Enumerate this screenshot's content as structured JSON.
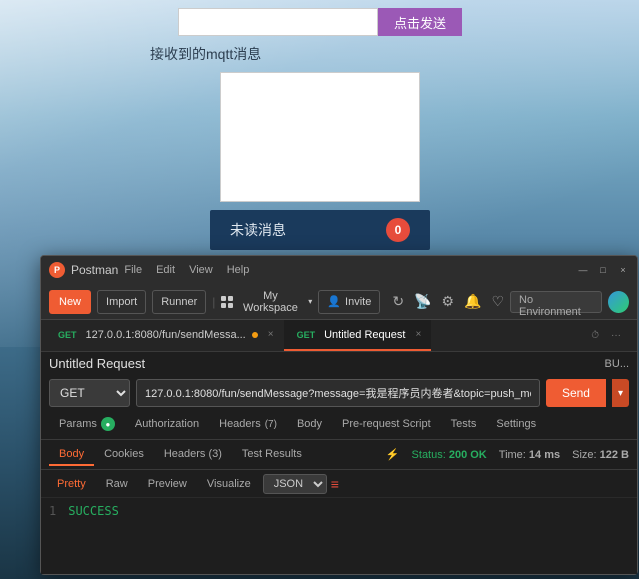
{
  "background": {
    "gradient_desc": "sky and mountain landscape"
  },
  "web_page": {
    "send_input_placeholder": "",
    "send_button_label": "点击发送",
    "mqtt_label": "接收到的mqtt消息",
    "textarea_content": "",
    "unread_text": "未读消息",
    "unread_count": "0"
  },
  "postman": {
    "title": "Postman",
    "menu": {
      "file": "File",
      "edit": "Edit",
      "view": "View",
      "help": "Help"
    },
    "toolbar": {
      "new_label": "New",
      "import_label": "Import",
      "runner_label": "Runner",
      "workspace_label": "My Workspace",
      "invite_label": "Invite"
    },
    "env_selector": "No Environment",
    "tabs": [
      {
        "method": "GET",
        "url": "127.0.0.1:8080/fun/sendMessa...",
        "has_dot": true,
        "is_active": false
      },
      {
        "method": "GET",
        "url": "Untitled Request",
        "has_dot": false,
        "is_active": true
      }
    ],
    "request": {
      "name": "Untitled Request",
      "method": "GET",
      "url": "127.0.0.1:8080/fun/sendMessage?message=我是程序员内卷者&topic=push_message_topic",
      "send_label": "Send",
      "params_tabs": [
        {
          "label": "Params",
          "badge": true,
          "badge_color": "#27ae60",
          "active": false
        },
        {
          "label": "Authorization",
          "active": false
        },
        {
          "label": "Headers",
          "count": "(7)",
          "active": false
        },
        {
          "label": "Body",
          "active": false
        },
        {
          "label": "Pre-request Script",
          "active": false
        },
        {
          "label": "Tests",
          "active": false
        },
        {
          "label": "Settings",
          "active": false
        }
      ]
    },
    "response": {
      "tabs": [
        {
          "label": "Body",
          "active": true
        },
        {
          "label": "Cookies",
          "active": false
        },
        {
          "label": "Headers",
          "count": "(3)",
          "active": false
        },
        {
          "label": "Test Results",
          "active": false
        }
      ],
      "status": "200 OK",
      "time": "14 ms",
      "size": "122 B",
      "format_btns": [
        "Pretty",
        "Raw",
        "Preview",
        "Visualize"
      ],
      "active_format": "Pretty",
      "format_select": "JSON",
      "body_lines": [
        {
          "number": "1",
          "content": "SUCCESS"
        }
      ]
    },
    "window_controls": {
      "minimize": "—",
      "maximize": "□",
      "close": "×"
    }
  }
}
